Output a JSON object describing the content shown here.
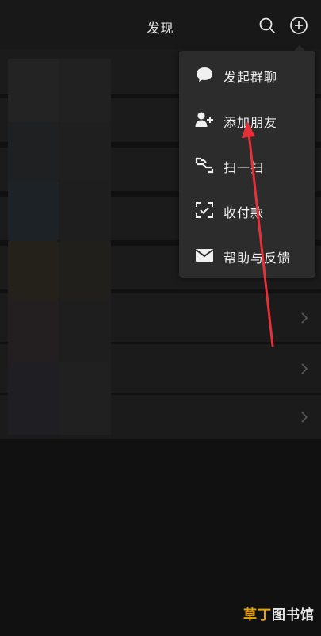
{
  "header": {
    "title": "发现"
  },
  "menu": {
    "items": [
      {
        "label": "发起群聊",
        "icon": "chat-bubble-icon"
      },
      {
        "label": "添加朋友",
        "icon": "add-friend-icon"
      },
      {
        "label": "扫一扫",
        "icon": "scan-icon"
      },
      {
        "label": "收付款",
        "icon": "payment-icon"
      },
      {
        "label": "帮助与反馈",
        "icon": "mail-icon"
      }
    ]
  },
  "watermark": {
    "part1": "草丁",
    "part2": "图书馆"
  },
  "colors": {
    "background": "#111111",
    "row": "#1b1b1b",
    "menu": "#2c2c2c",
    "annotation": "#e6313a"
  }
}
